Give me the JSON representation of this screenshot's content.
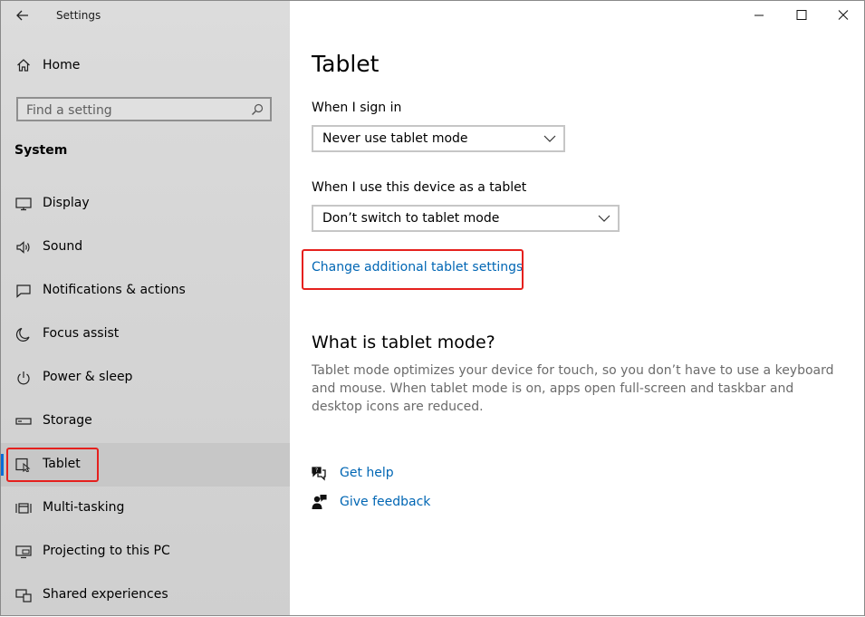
{
  "window": {
    "title": "Settings",
    "controls": [
      "minimize",
      "maximize",
      "close"
    ]
  },
  "sidebar": {
    "home_label": "Home",
    "search_placeholder": "Find a setting",
    "section_title": "System",
    "items": [
      {
        "label": "Display",
        "icon": "monitor-icon"
      },
      {
        "label": "Sound",
        "icon": "speaker-icon"
      },
      {
        "label": "Notifications & actions",
        "icon": "message-icon"
      },
      {
        "label": "Focus assist",
        "icon": "moon-icon"
      },
      {
        "label": "Power & sleep",
        "icon": "power-icon"
      },
      {
        "label": "Storage",
        "icon": "drive-icon"
      },
      {
        "label": "Tablet",
        "icon": "tablet-icon",
        "selected": true
      },
      {
        "label": "Multi-tasking",
        "icon": "multitask-icon"
      },
      {
        "label": "Projecting to this PC",
        "icon": "project-icon"
      },
      {
        "label": "Shared experiences",
        "icon": "shared-icon"
      }
    ]
  },
  "main": {
    "title": "Tablet",
    "signin_label": "When I sign in",
    "signin_value": "Never use tablet mode",
    "tablet_label": "When I use this device as a tablet",
    "tablet_value": "Don’t switch to tablet mode",
    "additional_link": "Change additional tablet settings",
    "what_title": "What is tablet mode?",
    "what_desc": "Tablet mode optimizes your device for touch, so you don’t have to use a keyboard and mouse. When tablet mode is on, apps open full-screen and taskbar and desktop icons are reduced.",
    "get_help": "Get help",
    "give_feedback": "Give feedback"
  },
  "colors": {
    "accent": "#0a6cd8",
    "link": "#0066b4",
    "highlight": "#e5201d"
  }
}
